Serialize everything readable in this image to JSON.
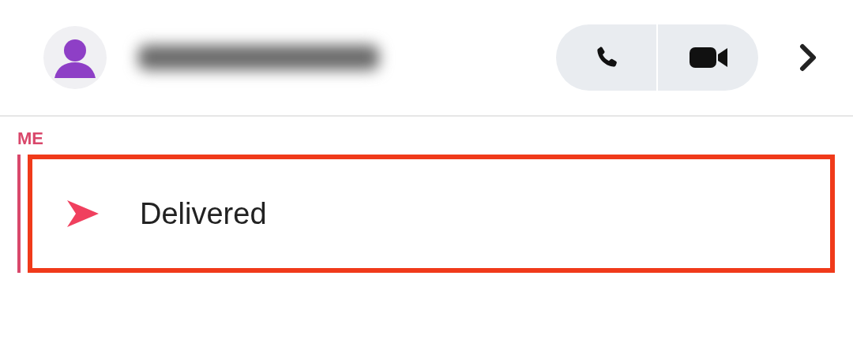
{
  "header": {
    "actions": [
      {
        "kind": "call"
      },
      {
        "kind": "video"
      }
    ]
  },
  "conversation": {
    "sender": "ME",
    "messages": [
      {
        "status": "Delivered",
        "highlighted": true
      }
    ]
  }
}
